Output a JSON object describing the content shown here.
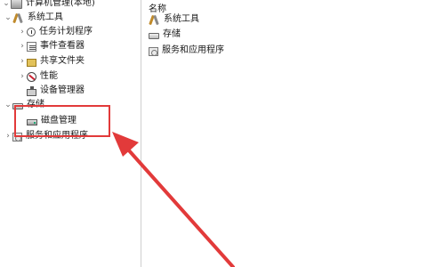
{
  "tree": {
    "root_label": "计算机管理(本地)",
    "system_tools_label": "系统工具",
    "task_scheduler_label": "任务计划程序",
    "event_viewer_label": "事件查看器",
    "shared_folders_label": "共享文件夹",
    "performance_label": "性能",
    "device_manager_label": "设备管理器",
    "storage_label": "存储",
    "disk_management_label": "磁盘管理",
    "services_apps_label": "服务和应用程序"
  },
  "right_panel": {
    "column_header": "名称",
    "items": [
      "系统工具",
      "存储",
      "服务和应用程序"
    ]
  },
  "annotation": {
    "highlight_color": "#e23a3a",
    "arrow_color": "#e23a3a"
  }
}
